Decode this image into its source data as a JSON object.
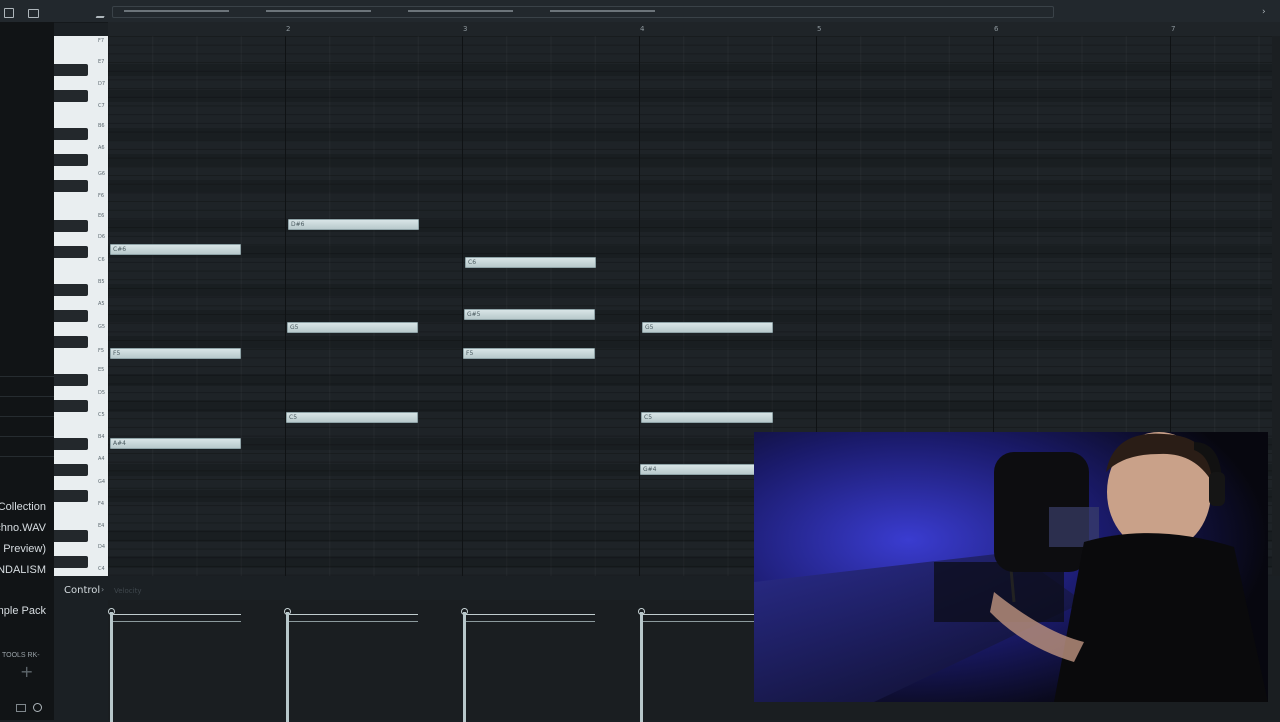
{
  "sidebar": {
    "items": [
      "Collection",
      "chno.WAV",
      "e Preview)",
      "ANDALISM",
      "mple Pack",
      "TOOLS RK-"
    ]
  },
  "ruler": {
    "bars": [
      "2",
      "3",
      "4",
      "5",
      "6",
      "7"
    ]
  },
  "keyboard": {
    "labels": [
      "F7",
      "E7",
      "D7",
      "C7",
      "B6",
      "A6",
      "G6",
      "F6",
      "E6",
      "D6",
      "C6",
      "B5",
      "A5",
      "G5",
      "F5",
      "E5",
      "D5",
      "C5",
      "B4",
      "A4",
      "G4",
      "F4",
      "E4",
      "D4",
      "C4"
    ]
  },
  "notes": [
    {
      "label": "C#6"
    },
    {
      "label": "F5"
    },
    {
      "label": "A#4"
    },
    {
      "label": "D#6"
    },
    {
      "label": "G5"
    },
    {
      "label": "C5"
    },
    {
      "label": "C6"
    },
    {
      "label": "G#5"
    },
    {
      "label": "F5"
    },
    {
      "label": "G5"
    },
    {
      "label": "C5"
    },
    {
      "label": "G#4"
    }
  ],
  "control": {
    "label": "Control",
    "arrow": "›",
    "param": "Velocity"
  },
  "colors": {
    "note": "#c9d8da",
    "background": "#1e2327",
    "keyboard": "#e9eef0"
  }
}
